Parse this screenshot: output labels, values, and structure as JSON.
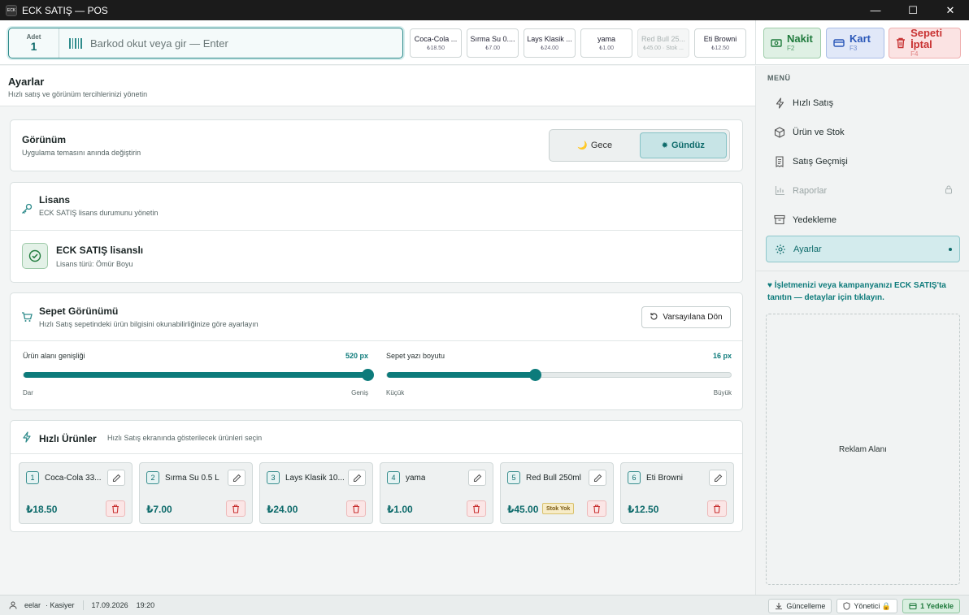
{
  "window": {
    "logo_text": "ECK",
    "title": "ECK SATIŞ — POS",
    "minimize": "—",
    "maximize": "☐",
    "close": "✕"
  },
  "scan": {
    "qty_label": "Adet",
    "qty_value": "1",
    "placeholder": "Barkod okut veya gir — Enter"
  },
  "quick_chips": [
    {
      "name": "Coca-Cola ...",
      "price": "₺18.50",
      "disabled": false
    },
    {
      "name": "Sırma Su 0....",
      "price": "₺7.00",
      "disabled": false
    },
    {
      "name": "Lays Klasik ...",
      "price": "₺24.00",
      "disabled": false
    },
    {
      "name": "yama",
      "price": "₺1.00",
      "disabled": false
    },
    {
      "name": "Red Bull 25...",
      "price": "₺45.00 · Stok ...",
      "disabled": true
    },
    {
      "name": "Eti Browni",
      "price": "₺12.50",
      "disabled": false
    }
  ],
  "payment": {
    "cash": {
      "label": "Nakit",
      "key": "F2",
      "color": "#1f7a3c"
    },
    "card": {
      "label": "Kart",
      "key": "F3",
      "color": "#2a57b8"
    },
    "cancel": {
      "label": "Sepeti İptal",
      "key": "F4",
      "color": "#c83232"
    }
  },
  "page": {
    "title": "Ayarlar",
    "subtitle": "Hızlı satış ve görünüm tercihlerinizi yönetin"
  },
  "theme": {
    "title": "Görünüm",
    "subtitle": "Uygulama temasını anında değiştirin",
    "options": {
      "night": "Gece",
      "day": "Gündüz"
    },
    "selected": "Gündüz"
  },
  "license": {
    "title": "Lisans",
    "subtitle": "ECK SATIŞ lisans durumunu yönetin",
    "status": "ECK SATIŞ lisanslı",
    "type": "Lisans türü: Ömür Boyu"
  },
  "cart_view": {
    "title": "Sepet Görünümü",
    "subtitle": "Hızlı Satış sepetindeki ürün bilgisini okunabilirliğinize göre ayarlayın",
    "reset_label": "Varsayılana Dön",
    "width_slider": {
      "label": "Ürün alanı genişliği",
      "value": "520 px",
      "min_label": "Dar",
      "max_label": "Geniş",
      "fraction": 1.0
    },
    "font_slider": {
      "label": "Sepet yazı boyutu",
      "value": "16 px",
      "min_label": "Küçük",
      "max_label": "Büyük",
      "fraction": 0.43
    }
  },
  "quick_products": {
    "title": "Hızlı Ürünler",
    "subtitle": "Hızlı Satış ekranında gösterilecek ürünleri seçin",
    "items": [
      {
        "num": "1",
        "name": "Coca-Cola 33...",
        "price": "₺18.50",
        "badge": ""
      },
      {
        "num": "2",
        "name": "Sırma Su 0.5 L",
        "price": "₺7.00",
        "badge": ""
      },
      {
        "num": "3",
        "name": "Lays Klasik 10...",
        "price": "₺24.00",
        "badge": ""
      },
      {
        "num": "4",
        "name": "yama",
        "price": "₺1.00",
        "badge": ""
      },
      {
        "num": "5",
        "name": "Red Bull 250ml",
        "price": "₺45.00",
        "badge": "Stok Yok"
      },
      {
        "num": "6",
        "name": "Eti Browni",
        "price": "₺12.50",
        "badge": ""
      }
    ]
  },
  "sidebar": {
    "menu_label": "MENÜ",
    "items": [
      {
        "label": "Hızlı Satış",
        "icon": "lightning-icon",
        "state": "normal"
      },
      {
        "label": "Ürün ve Stok",
        "icon": "box-icon",
        "state": "normal"
      },
      {
        "label": "Satış Geçmişi",
        "icon": "receipt-icon",
        "state": "normal"
      },
      {
        "label": "Raporlar",
        "icon": "chart-icon",
        "state": "disabled"
      },
      {
        "label": "Yedekleme",
        "icon": "archive-icon",
        "state": "normal"
      },
      {
        "label": "Ayarlar",
        "icon": "gear-icon",
        "state": "active"
      }
    ],
    "promo": "♥ İşletmenizi veya kampanyanızı ECK SATIŞ'ta tanıtın — detaylar için tıklayın.",
    "ad_label": "Reklam Alanı"
  },
  "status": {
    "user": "eelar",
    "role": "· Kasiyer",
    "date": "17.09.2026",
    "time": "19:20",
    "update_label": "Güncelleme",
    "admin_label": "Yönetici 🔒",
    "backup_label": "1 Yedekle"
  }
}
